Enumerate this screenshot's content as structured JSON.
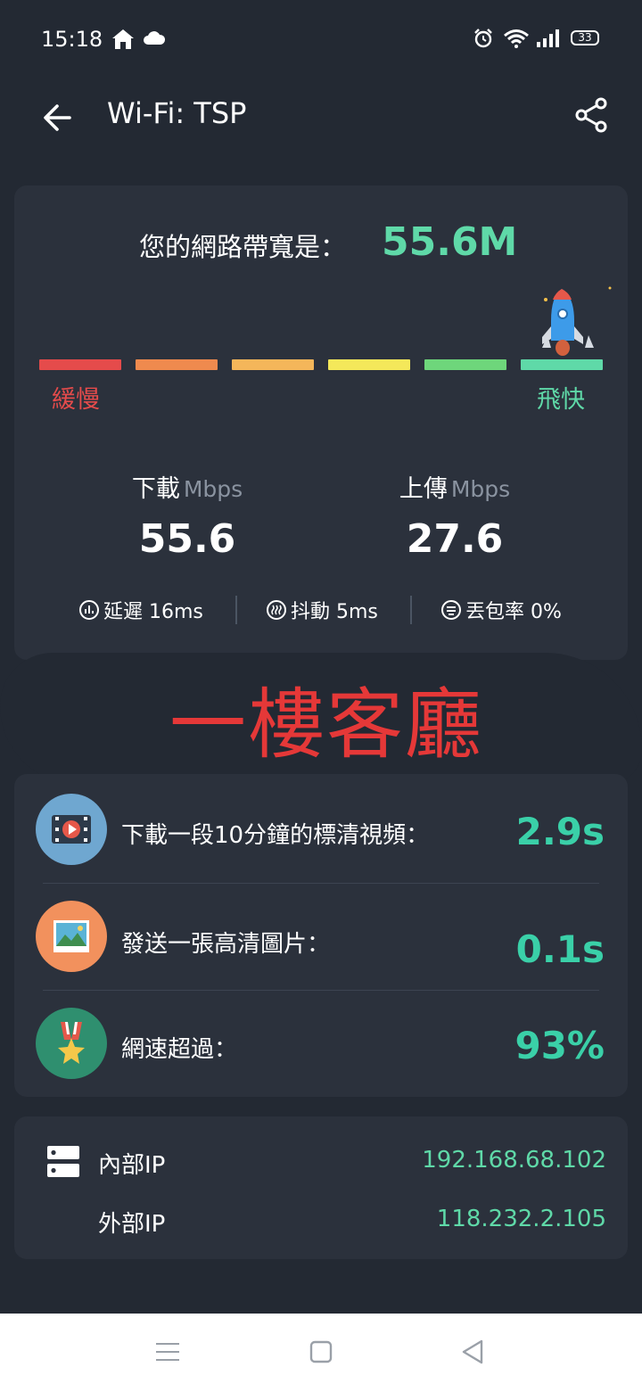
{
  "status_bar": {
    "time": "15:18",
    "battery": "33"
  },
  "app_bar": {
    "title": "Wi-Fi: TSP"
  },
  "speed": {
    "bandwidth_label": "您的網路帶寬是：",
    "bandwidth_value": "55.6M",
    "scale_slow": "緩慢",
    "scale_fast": "飛快",
    "scale_colors": [
      "#e54b4b",
      "#ef8a4e",
      "#f4b65a",
      "#f4e85a",
      "#6ed67b",
      "#5fd9a8"
    ],
    "download_label": "下載",
    "download_unit": "Mbps",
    "download_value": "55.6",
    "upload_label": "上傳",
    "upload_unit": "Mbps",
    "upload_value": "27.6",
    "latency": "延遲 16ms",
    "jitter": "抖動 5ms",
    "packet_loss": "丟包率 0%"
  },
  "annotation": {
    "handwritten": "一樓客廳"
  },
  "estimates": [
    {
      "icon": "video-icon",
      "label": "下載一段10分鐘的標清視頻：",
      "value": "2.9s"
    },
    {
      "icon": "picture-icon",
      "label": "發送一張高清圖片：",
      "value": "0.1s"
    },
    {
      "icon": "medal-icon",
      "label": "網速超過：",
      "value": "93%"
    }
  ],
  "ip": {
    "internal_label": "內部IP",
    "internal_value": "192.168.68.102",
    "external_label": "外部IP",
    "external_value": "118.232.2.105"
  },
  "colors": {
    "background": "#232933",
    "card": "#2b313c",
    "accent": "#5fd9a8",
    "accent_strong": "#3ad0a8",
    "handwriting": "#e53838"
  }
}
